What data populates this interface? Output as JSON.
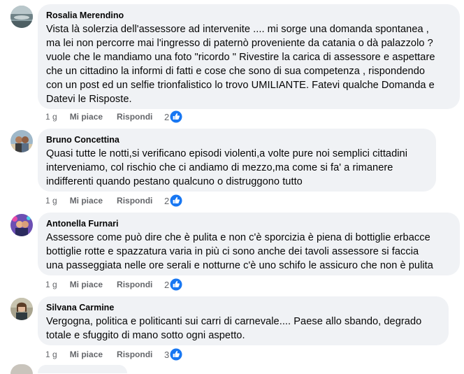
{
  "comments": [
    {
      "author": "Rosalia Merendino",
      "text": "Vista là solerzia dell'assessore ad intervenite .... mi sorge una domanda spontanea ,\nma lei non percorre mai l'ingresso di paternò proveniente da catania o dà palazzolo ?\nvuole che le mandiamo una foto \"ricordo \" Rivestire la carica di assessore e aspettare\nche un cittadino la informi di fatti e cose che sono di sua competenza , rispondendo\ncon un post ed un selfie trionfalistico lo trovo UMILIANTE. Fatevi qualche Domanda e\nDatevi le Risposte.",
      "time": "1 g",
      "like_label": "Mi piace",
      "reply_label": "Rispondi",
      "reaction_count": "2"
    },
    {
      "author": "Bruno Concettina",
      "text": "Quasi tutte le notti,si verificano episodi violenti,a volte pure noi semplici cittadini\ninterveniamo, col rischio che ci andiamo di mezzo,ma come si fa' a rimanere\nindifferenti quando pestano qualcuno o distruggono tutto",
      "time": "1 g",
      "like_label": "Mi piace",
      "reply_label": "Rispondi",
      "reaction_count": "2"
    },
    {
      "author": "Antonella Furnari",
      "text": "Assessore come può dire che è pulita e non c'è sporcizia è piena di bottiglie erbacce\nbottiglie rotte e spazzatura varia in più ci sono anche dei tavoli assessore si faccia\nuna passeggiata nelle ore serali e notturne c'è uno schifo le assicuro che non è pulita",
      "time": "1 g",
      "like_label": "Mi piace",
      "reply_label": "Rispondi",
      "reaction_count": "2"
    },
    {
      "author": "Silvana Carmine",
      "text": "Vergogna, politica e politicanti sui carri di carnevale.... Paese allo sbando, degrado\ntotale e sfuggito di mano sotto ogni aspetto.",
      "time": "1 g",
      "like_label": "Mi piace",
      "reply_label": "Rispondi",
      "reaction_count": "3"
    }
  ],
  "colors": {
    "bubble": "#f0f2f5",
    "secondary_text": "#65676b",
    "like_blue": "#1877f2"
  },
  "icons": {
    "reaction": "like-thumb-icon"
  }
}
